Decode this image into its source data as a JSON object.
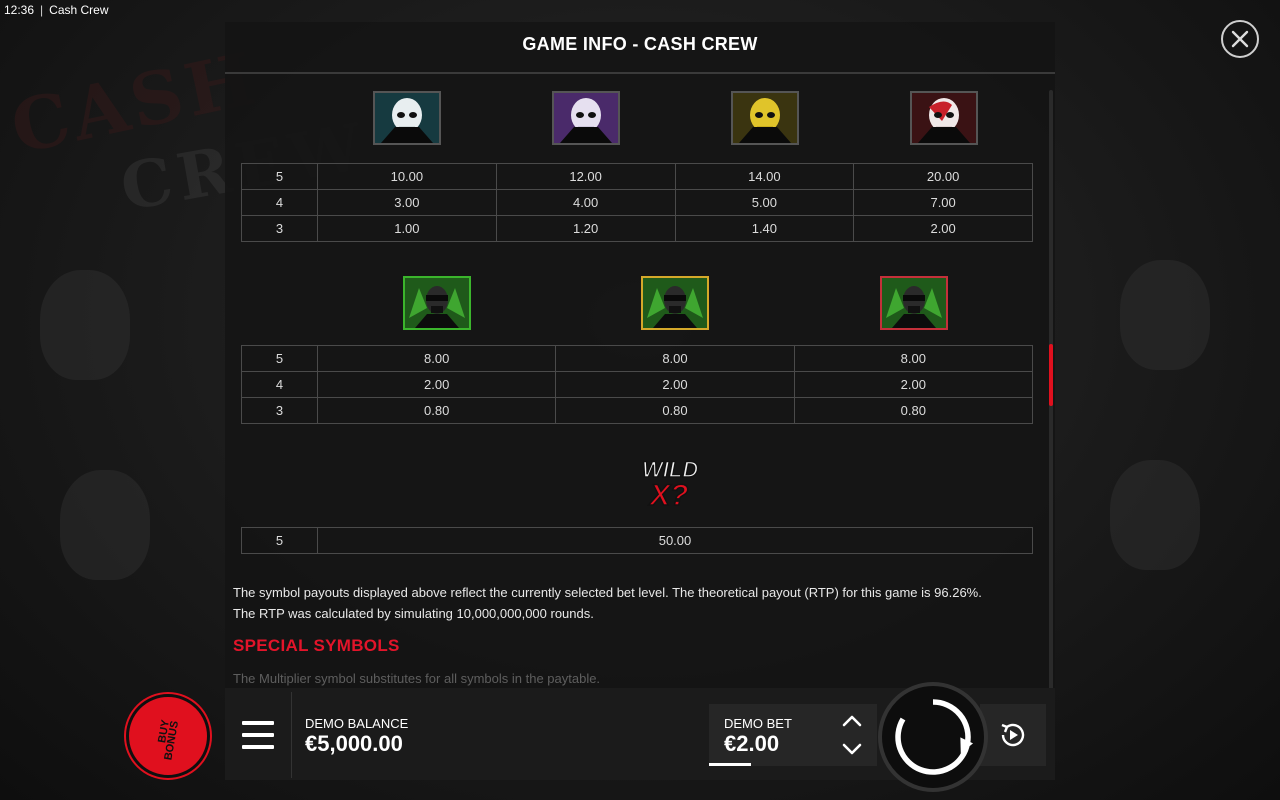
{
  "status_bar": {
    "time": "12:36",
    "separator": "|",
    "app_name": "Cash Crew"
  },
  "panel": {
    "title": "GAME INFO - CASH CREW",
    "close_icon": "close-icon"
  },
  "high_symbols": {
    "icons": [
      "skull-cyan-icon",
      "skull-purple-icon",
      "skull-yellow-icon",
      "skull-red-icon"
    ],
    "rows": [
      {
        "count": "5",
        "values": [
          "10.00",
          "12.00",
          "14.00",
          "20.00"
        ]
      },
      {
        "count": "4",
        "values": [
          "3.00",
          "4.00",
          "5.00",
          "7.00"
        ]
      },
      {
        "count": "3",
        "values": [
          "1.00",
          "1.20",
          "1.40",
          "2.00"
        ]
      }
    ]
  },
  "mid_symbols": {
    "icons": [
      "gangster-green-frame-icon",
      "gangster-gold-frame-icon",
      "gangster-red-frame-icon"
    ],
    "frame_colors": [
      "#3bb52c",
      "#d4a82a",
      "#c4303a"
    ],
    "rows": [
      {
        "count": "5",
        "values": [
          "8.00",
          "8.00",
          "8.00"
        ]
      },
      {
        "count": "4",
        "values": [
          "2.00",
          "2.00",
          "2.00"
        ]
      },
      {
        "count": "3",
        "values": [
          "0.80",
          "0.80",
          "0.80"
        ]
      }
    ]
  },
  "wild_symbol": {
    "icon": "wild-x-icon",
    "logo_text": "WILD X?",
    "rows": [
      {
        "count": "5",
        "value": "50.00"
      }
    ]
  },
  "description": {
    "line1": "The symbol payouts displayed above reflect the currently selected bet level. The theoretical payout (RTP) for this game is 96.26%.",
    "line2": "The RTP was calculated by simulating 10,000,000,000 rounds."
  },
  "special_symbols": {
    "heading": "SPECIAL SYMBOLS",
    "text": "The Multiplier symbol substitutes for all symbols in the paytable."
  },
  "bottom_bar": {
    "buy_bonus_line1": "BUY",
    "buy_bonus_line2": "BONUS",
    "balance_label": "DEMO BALANCE",
    "balance_value": "€5,000.00",
    "bet_label": "DEMO BET",
    "bet_value": "€2.00"
  },
  "colors": {
    "accent_red": "#e3142a",
    "panel_bg": "#141414"
  }
}
